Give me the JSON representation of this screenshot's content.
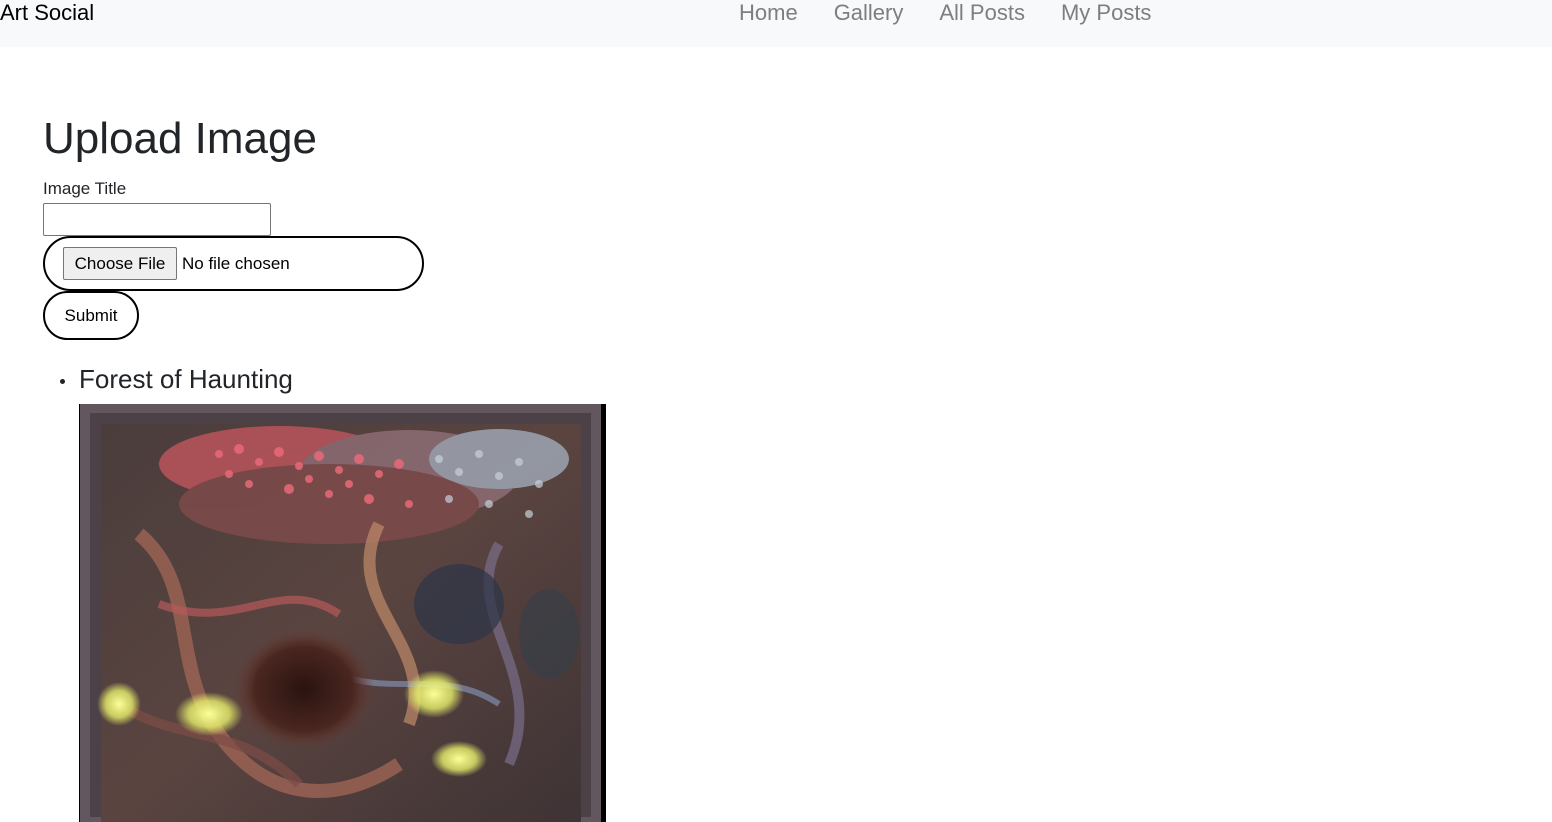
{
  "navbar": {
    "brand": "Art Social",
    "links": [
      {
        "label": "Home"
      },
      {
        "label": "Gallery"
      },
      {
        "label": "All Posts"
      },
      {
        "label": "My Posts"
      }
    ]
  },
  "upload": {
    "title": "Upload Image",
    "image_title_label": "Image Title",
    "image_title_value": "",
    "choose_file_label": "Choose File",
    "file_status": "No file chosen",
    "submit_label": "Submit"
  },
  "posts": [
    {
      "title": "Forest of Haunting"
    }
  ],
  "colors": {
    "navbar_bg": "#f8f9fa",
    "nav_link": "#7b7f83",
    "text": "#212529"
  }
}
